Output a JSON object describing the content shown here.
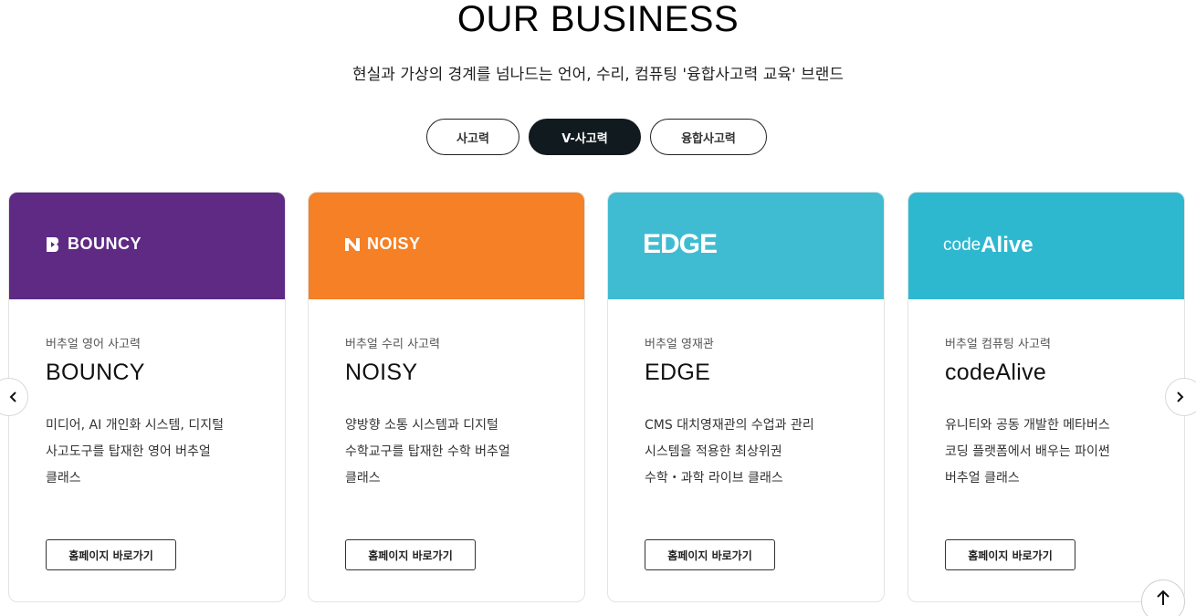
{
  "section": {
    "title": "OUR BUSINESS",
    "subtitle": "현실과 가상의 경계를 넘나드는 언어, 수리, 컴퓨팅 '융합사고력 교육' 브랜드"
  },
  "tabs": [
    {
      "label": "사고력",
      "active": false
    },
    {
      "label": "V-사고력",
      "active": true
    },
    {
      "label": "융합사고력",
      "active": false
    }
  ],
  "cards": [
    {
      "logo": "BOUNCY",
      "category": "버추얼 영어 사고력",
      "name": "BOUNCY",
      "desc": [
        "미디어, AI 개인화 시스템, 디지털",
        "사고도구를 탑재한 영어 버추얼",
        "클래스"
      ],
      "button": "홈페이지 바로가기",
      "color": "#5e2a84"
    },
    {
      "logo": "NOISY",
      "category": "버추얼 수리 사고력",
      "name": "NOISY",
      "desc": [
        "양방향 소통 시스템과 디지털",
        "수학교구를 탑재한 수학 버추얼",
        "클래스"
      ],
      "button": "홈페이지 바로가기",
      "color": "#f58025"
    },
    {
      "logo": "EDGE",
      "category": "버추얼 영재관",
      "name": "EDGE",
      "desc": [
        "CMS 대치영재관의 수업과 관리",
        "시스템을 적용한 최상위권",
        "수학・과학 라이브 클래스"
      ],
      "button": "홈페이지 바로가기",
      "color": "#40bcd2"
    },
    {
      "logo_prefix": "code",
      "logo_suffix": "Alive",
      "category": "버추얼 컴퓨팅 사고력",
      "name": "codeAlive",
      "desc": [
        "유니티와 공동 개발한 메타버스",
        "코딩 플랫폼에서 배우는 파이썬",
        "버추얼 클래스"
      ],
      "button": "홈페이지 바로가기",
      "color": "#2eb8d0"
    }
  ],
  "nav": {
    "prev_icon": "chevron-left-icon",
    "next_icon": "chevron-right-icon",
    "top_icon": "arrow-up-icon"
  }
}
